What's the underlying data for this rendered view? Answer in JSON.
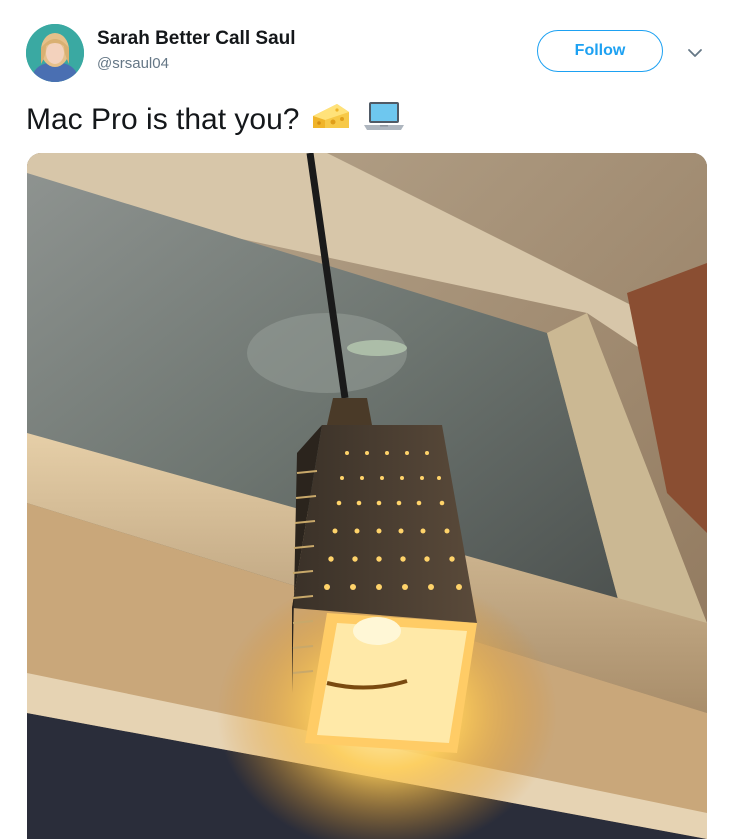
{
  "user": {
    "display_name": "Sarah Better Call Saul",
    "handle": "@srsaul04"
  },
  "follow_button": {
    "label": "Follow"
  },
  "tweet": {
    "text": "Mac Pro is that you?",
    "emojis": [
      "cheese-wedge",
      "laptop"
    ]
  },
  "media": {
    "description_icon": "photo-of-cheese-grater-lamp"
  },
  "colors": {
    "accent": "#1da1f2",
    "text_primary": "#14171a",
    "text_secondary": "#657786"
  }
}
